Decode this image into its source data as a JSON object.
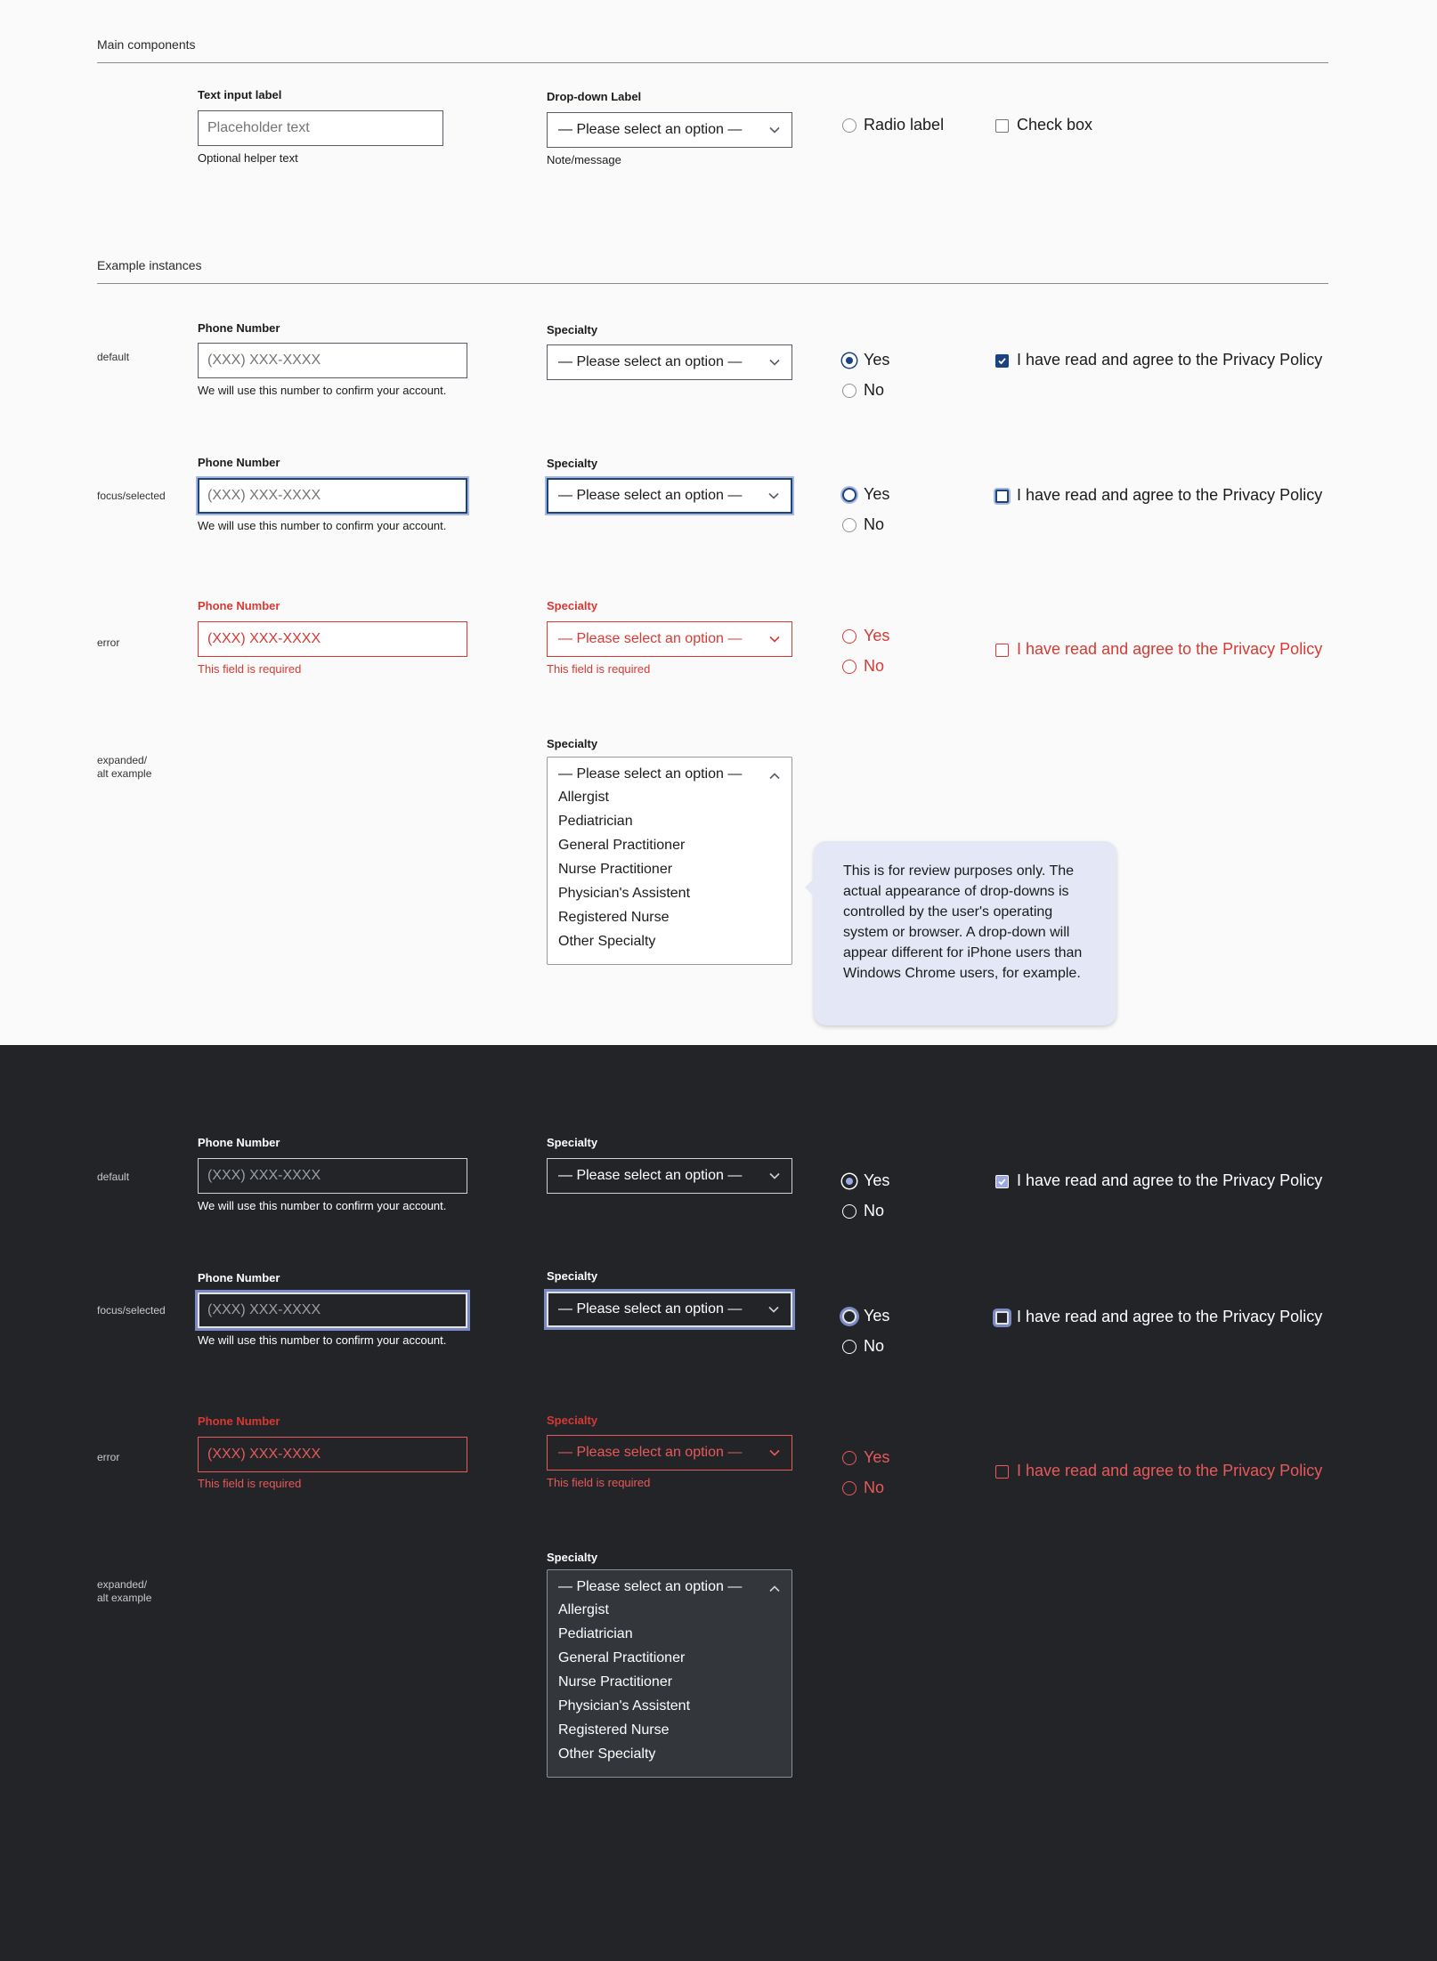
{
  "sections": {
    "main_components": "Main components",
    "example_instances": "Example instances"
  },
  "main": {
    "text_label": "Text input label",
    "text_placeholder": "Placeholder text",
    "text_helper": "Optional helper text",
    "dropdown_label": "Drop-down Label",
    "dropdown_value": "— Please select an option —",
    "dropdown_note": "Note/message",
    "radio_label": "Radio label",
    "checkbox_label": "Check box"
  },
  "states": {
    "default": "default",
    "focus": "focus/selected",
    "error": "error",
    "expanded": "expanded/\nalt example"
  },
  "form": {
    "phone_label": "Phone Number",
    "phone_placeholder": "(XXX) XXX-XXXX",
    "phone_helper": "We will use this number to confirm your account.",
    "specialty_label": "Specialty",
    "select_value": "— Please select an option —",
    "error_message": "This field is required",
    "radio_yes": "Yes",
    "radio_no": "No",
    "privacy_label": "I have read and agree to the Privacy Policy"
  },
  "specialty_options": [
    "Allergist",
    "Pediatrician",
    "General Practitioner",
    "Nurse Practitioner",
    "Physician's Assistent",
    "Registered Nurse",
    "Other Specialty"
  ],
  "tooltip": {
    "text": "This is for review purposes only. The actual appearance of drop-downs is controlled by the user's operating system or browser. A drop-down will appear different for iPhone users than Windows Chrome users, for example."
  },
  "colors": {
    "primary": "#1a4480",
    "error": "#d83933",
    "dark_background": "#222428",
    "tooltip_background": "#e4e7f6"
  }
}
